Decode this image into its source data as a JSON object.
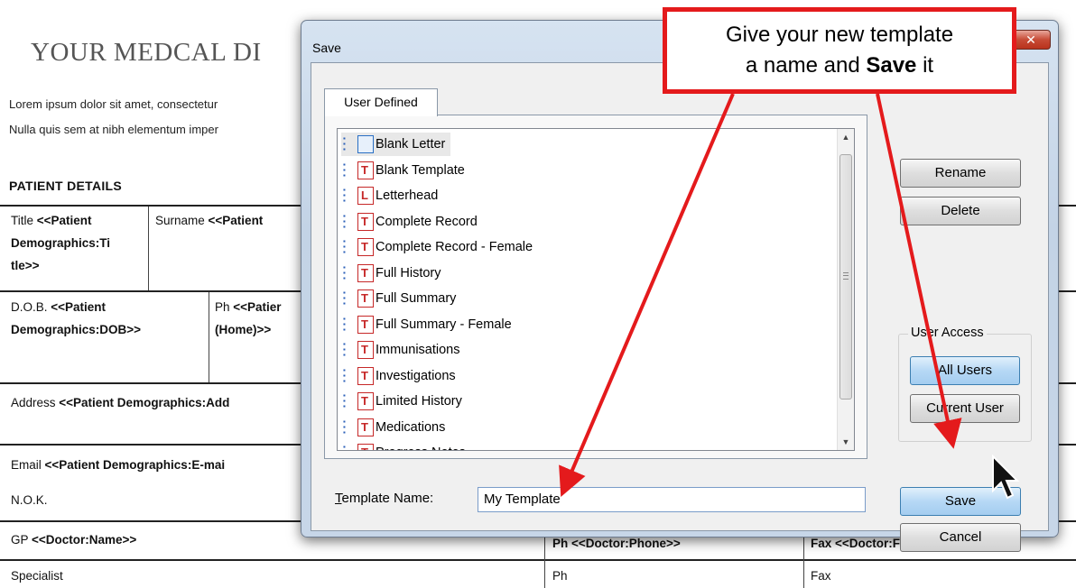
{
  "document": {
    "title": "YOUR MEDCAL DI",
    "lorem_lines": [
      "Lorem ipsum dolor sit amet, consectetur",
      "Nulla quis sem at nibh elementum imper"
    ],
    "section_heading": "PATIENT DETAILS",
    "rows": {
      "title_label": "Title ",
      "title_value_1": "<<Patient",
      "title_value_2": "Demographics:Ti",
      "title_value_3": "tle>>",
      "surname_label": "Surname ",
      "surname_value": "<<Patient",
      "dob_label": "D.O.B. ",
      "dob_value_1": "<<Patient",
      "dob_value_2": "Demographics:DOB>>",
      "ph_label": "Ph ",
      "ph_value_1": "<<Patier",
      "ph_value_2": "(Home)>>",
      "address_label": "Address ",
      "address_value": "<<Patient Demographics:Add",
      "email_label": "Email ",
      "email_value": "<<Patient Demographics:E-mai",
      "nok_label": "N.O.K.",
      "gp_label": "GP ",
      "gp_value": "<<Doctor:Name>>",
      "gp_ph": "Ph <<Doctor:Phone>>",
      "gp_fax": "Fax <<Doctor:Fax>>",
      "specialist_label": "Specialist",
      "specialist_ph": "Ph",
      "specialist_fax": "Fax"
    }
  },
  "dialog": {
    "title": "Save",
    "close_glyph": "✕",
    "tab_label": "User Defined",
    "templates": [
      {
        "label": "Blank Letter",
        "icon": "blank-document-icon",
        "glyph": "",
        "selected": true
      },
      {
        "label": "Blank Template",
        "icon": "template-document-icon",
        "glyph": "T",
        "selected": false
      },
      {
        "label": "Letterhead",
        "icon": "letterhead-document-icon",
        "glyph": "L",
        "selected": false
      },
      {
        "label": "Complete Record",
        "icon": "template-document-icon",
        "glyph": "T",
        "selected": false
      },
      {
        "label": "Complete Record - Female",
        "icon": "template-document-icon",
        "glyph": "T",
        "selected": false
      },
      {
        "label": "Full History",
        "icon": "template-document-icon",
        "glyph": "T",
        "selected": false
      },
      {
        "label": "Full Summary",
        "icon": "template-document-icon",
        "glyph": "T",
        "selected": false
      },
      {
        "label": "Full Summary - Female",
        "icon": "template-document-icon",
        "glyph": "T",
        "selected": false
      },
      {
        "label": "Immunisations",
        "icon": "template-document-icon",
        "glyph": "T",
        "selected": false
      },
      {
        "label": "Investigations",
        "icon": "template-document-icon",
        "glyph": "T",
        "selected": false
      },
      {
        "label": "Limited History",
        "icon": "template-document-icon",
        "glyph": "T",
        "selected": false
      },
      {
        "label": "Medications",
        "icon": "template-document-icon",
        "glyph": "T",
        "selected": false
      },
      {
        "label": "Progress Notes",
        "icon": "template-document-icon",
        "glyph": "T",
        "selected": false
      }
    ],
    "buttons": {
      "rename": "Rename",
      "delete": "Delete",
      "all_users": "All Users",
      "current_user": "Current User",
      "save": "Save",
      "cancel": "Cancel"
    },
    "user_access_label": "User Access",
    "template_name_label_prefix": "T",
    "template_name_label_rest": "emplate Name:",
    "template_name_value": "My Template",
    "scroll_up_glyph": "▲",
    "scroll_down_glyph": "▼"
  },
  "callout": {
    "line1": "Give your new template",
    "line2_pre": "a name and ",
    "line2_bold": "Save",
    "line2_post": " it"
  },
  "colors": {
    "callout_red": "#e41a1c",
    "dialog_frame": "#c3d3e6",
    "selected_button": "#b6d8f5"
  }
}
